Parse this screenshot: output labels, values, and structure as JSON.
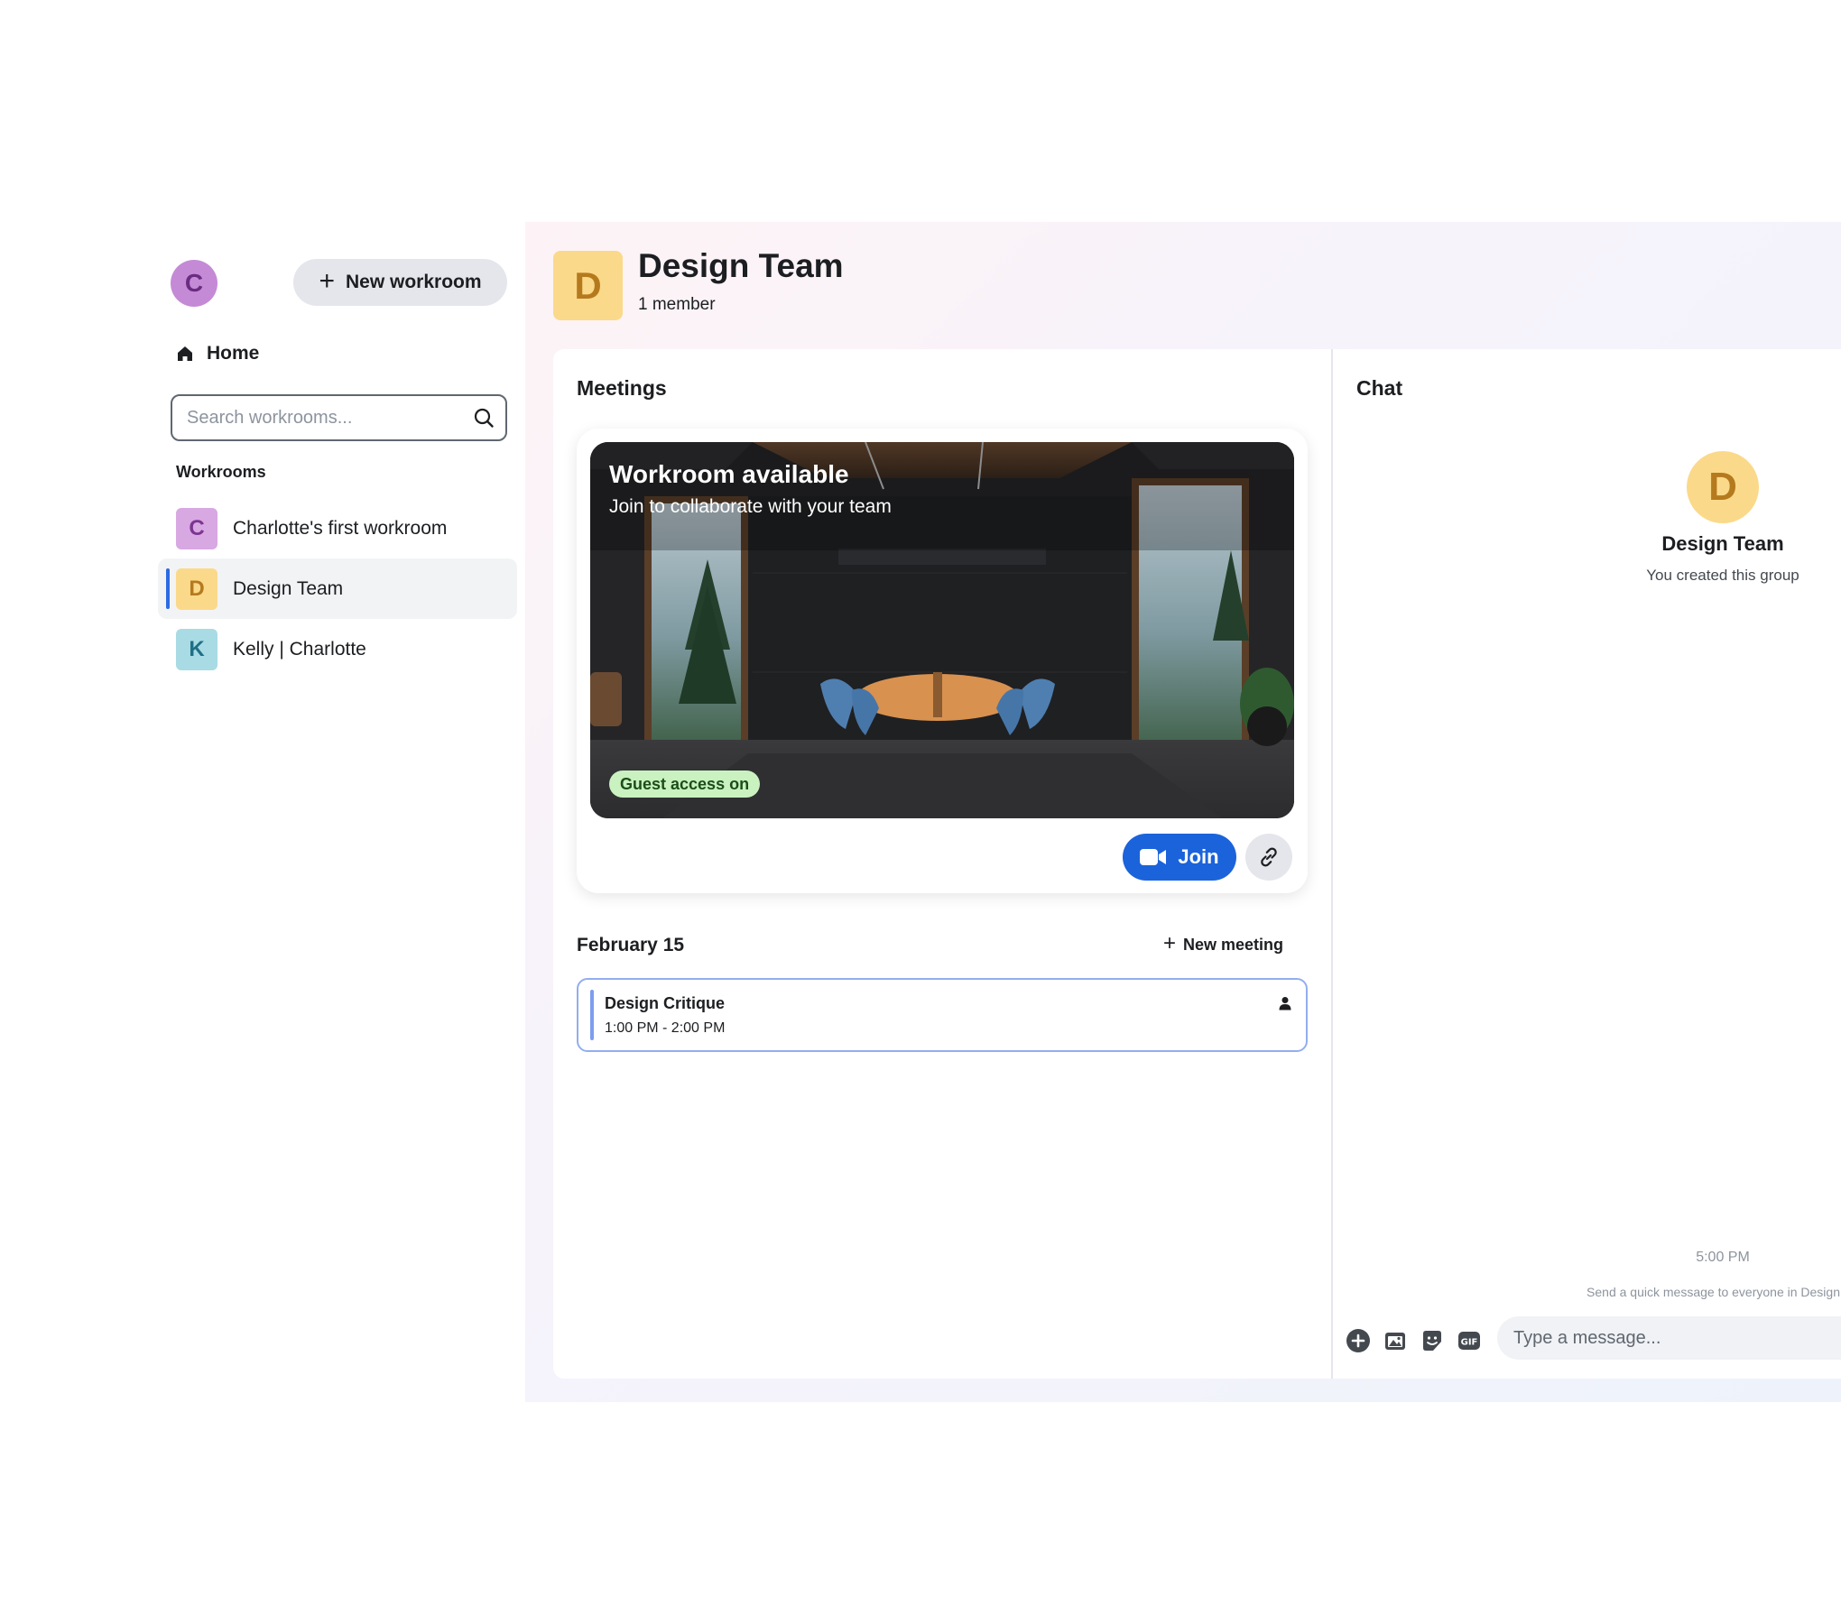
{
  "sidebar": {
    "user_initial": "C",
    "new_workroom_label": "New workroom",
    "home_label": "Home",
    "search_placeholder": "Search workrooms...",
    "workrooms_heading": "Workrooms",
    "workrooms": [
      {
        "initial": "C",
        "name": "Charlotte's first workroom",
        "bg": "#d8a8e2",
        "fg": "#7b3592"
      },
      {
        "initial": "D",
        "name": "Design Team",
        "bg": "#fbd98a",
        "fg": "#b57a1e",
        "active": true
      },
      {
        "initial": "K",
        "name": "Kelly | Charlotte",
        "bg": "#a8dbe4",
        "fg": "#1f6f86"
      }
    ]
  },
  "header": {
    "initial": "D",
    "title": "Design Team",
    "members": "1 member"
  },
  "meetings": {
    "title": "Meetings",
    "card": {
      "title": "Workroom available",
      "subtitle": "Join to collaborate with your team",
      "badge": "Guest access on",
      "join_label": "Join"
    },
    "date": "February 15",
    "new_meeting_label": "New meeting",
    "items": [
      {
        "title": "Design Critique",
        "time": "1:00 PM - 2:00 PM"
      }
    ]
  },
  "chat": {
    "title": "Chat",
    "group_initial": "D",
    "group_name": "Design Team",
    "created_text": "You created this group",
    "timestamp": "5:00 PM",
    "hint": "Send a quick message to everyone in Design",
    "input_placeholder": "Type a message..."
  },
  "colors": {
    "accent": "#1b63db",
    "active_indicator": "#2d6ae3",
    "guest_badge": "#c9f2c0"
  }
}
